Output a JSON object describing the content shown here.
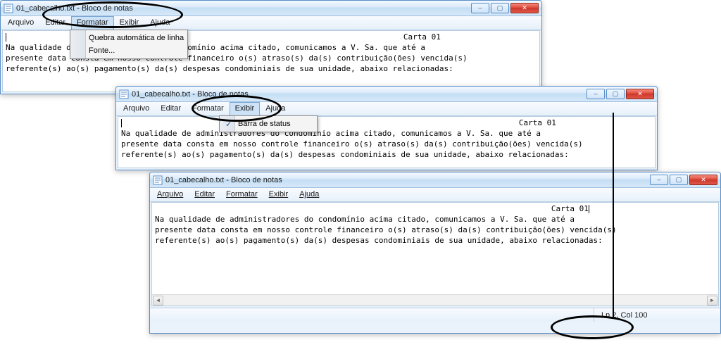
{
  "windows": {
    "w1": {
      "title": "01_cabecalho.txt - Bloco de notas",
      "menus": {
        "arquivo": "Arquivo",
        "editar": "Editar",
        "formatar": "Formatar",
        "exibir": "Exibir",
        "ajuda": "Ajuda"
      },
      "formatar_dropdown": {
        "quebra": "Quebra automática de linha",
        "fonte": "Fonte..."
      },
      "body_header": "                                                                                     Carta 01",
      "body_lines": "Na qualidade de administradores do condomínio acima citado, comunicamos a V. Sa. que até a\npresente data consta em nosso controle financeiro o(s) atraso(s) da(s) contribuição(ões) vencida(s)\nreferente(s) ao(s) pagamento(s) da(s) despesas condominiais de sua unidade, abaixo relacionadas:"
    },
    "w2": {
      "title": "01_cabecalho.txt - Bloco de notas",
      "menus": {
        "arquivo": "Arquivo",
        "editar": "Editar",
        "formatar": "Formatar",
        "exibir": "Exibir",
        "ajuda": "Ajuda"
      },
      "exibir_dropdown": {
        "barra": "Barra de status"
      },
      "body_header": "                                                                                     Carta 01",
      "body_lines": "Na qualidade de administradores do condomínio acima citado, comunicamos a V. Sa. que até a\npresente data consta em nosso controle financeiro o(s) atraso(s) da(s) contribuição(ões) vencida(s)\nreferente(s) ao(s) pagamento(s) da(s) despesas condominiais de sua unidade, abaixo relacionadas:"
    },
    "w3": {
      "title": "01_cabecalho.txt - Bloco de notas",
      "menus": {
        "arquivo": "Arquivo",
        "editar": "Editar",
        "formatar": "Formatar",
        "exibir": "Exibir",
        "ajuda": "Ajuda"
      },
      "body_header": "                                                                                     Carta 01",
      "body_lines": "Na qualidade de administradores do condomínio acima citado, comunicamos a V. Sa. que até a\npresente data consta em nosso controle financeiro o(s) atraso(s) da(s) contribuição(ões) vencida(s)\nreferente(s) ao(s) pagamento(s) da(s) despesas condominiais de sua unidade, abaixo relacionadas:",
      "status": "Ln 2, Col 100"
    }
  },
  "glyphs": {
    "min": "–",
    "max": "▢",
    "close": "✕",
    "check": "✓",
    "left": "◄",
    "right": "►"
  }
}
